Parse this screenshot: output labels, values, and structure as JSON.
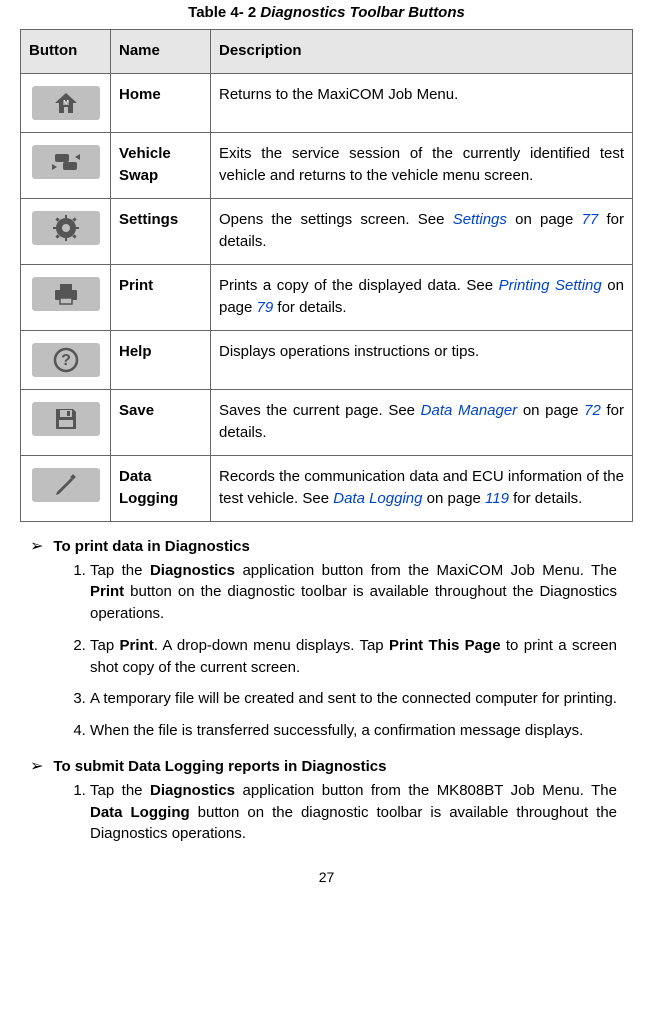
{
  "caption": {
    "label": "Table 4- 2",
    "title": "Diagnostics Toolbar Buttons"
  },
  "headers": {
    "button": "Button",
    "name": "Name",
    "desc": "Description"
  },
  "rows": [
    {
      "icon": "home",
      "name": "Home",
      "desc_plain": "Returns to the MaxiCOM Job Menu."
    },
    {
      "icon": "vehicle-swap",
      "name": "Vehicle Swap",
      "desc_plain": "Exits the service session of the currently identified test vehicle and returns to the vehicle menu screen."
    },
    {
      "icon": "settings",
      "name": "Settings",
      "desc_pre": "Opens the settings screen. See ",
      "link": "Settings",
      "desc_mid": " on page ",
      "page": "77",
      "desc_post": " for details."
    },
    {
      "icon": "print",
      "name": "Print",
      "desc_pre": "Prints a copy of the displayed data. See ",
      "link": "Printing Setting",
      "desc_mid": " on page ",
      "page": "79",
      "desc_post": " for details."
    },
    {
      "icon": "help",
      "name": "Help",
      "desc_plain": "Displays operations instructions or tips."
    },
    {
      "icon": "save",
      "name": "Save",
      "desc_pre": "Saves the current page. See ",
      "link": "Data Manager",
      "desc_mid": " on page ",
      "page": "72",
      "desc_post": " for details."
    },
    {
      "icon": "data-logging",
      "name": "Data Logging",
      "desc_pre": "Records the communication data and ECU information of the test vehicle. See ",
      "link": "Data Logging",
      "desc_mid": " on page ",
      "page": "119",
      "desc_post": " for details."
    }
  ],
  "sections": [
    {
      "heading": "To print data in Diagnostics",
      "steps": [
        {
          "parts": [
            {
              "t": "plain",
              "v": "Tap the "
            },
            {
              "t": "bold",
              "v": "Diagnostics"
            },
            {
              "t": "plain",
              "v": " application button from the MaxiCOM Job Menu. The "
            },
            {
              "t": "bold",
              "v": "Print"
            },
            {
              "t": "plain",
              "v": " button on the diagnostic toolbar is available throughout the Diagnostics operations."
            }
          ]
        },
        {
          "parts": [
            {
              "t": "plain",
              "v": "Tap "
            },
            {
              "t": "bold",
              "v": "Print"
            },
            {
              "t": "plain",
              "v": ". A drop-down menu displays. Tap "
            },
            {
              "t": "bold",
              "v": "Print This Page"
            },
            {
              "t": "plain",
              "v": " to print a screen shot copy of the current screen."
            }
          ]
        },
        {
          "parts": [
            {
              "t": "plain",
              "v": "A temporary file will be created and sent to the connected computer for printing."
            }
          ]
        },
        {
          "parts": [
            {
              "t": "plain",
              "v": "When the file is transferred successfully, a confirmation message displays."
            }
          ]
        }
      ]
    },
    {
      "heading": "To submit Data Logging reports in Diagnostics",
      "steps": [
        {
          "parts": [
            {
              "t": "plain",
              "v": "Tap the "
            },
            {
              "t": "bold",
              "v": "Diagnostics"
            },
            {
              "t": "plain",
              "v": " application button from the MK808BT Job Menu. The "
            },
            {
              "t": "bold",
              "v": "Data Logging"
            },
            {
              "t": "plain",
              "v": " button on the diagnostic toolbar is available throughout the Diagnostics operations."
            }
          ]
        }
      ]
    }
  ],
  "arrow": "➢",
  "pagenum": "27"
}
